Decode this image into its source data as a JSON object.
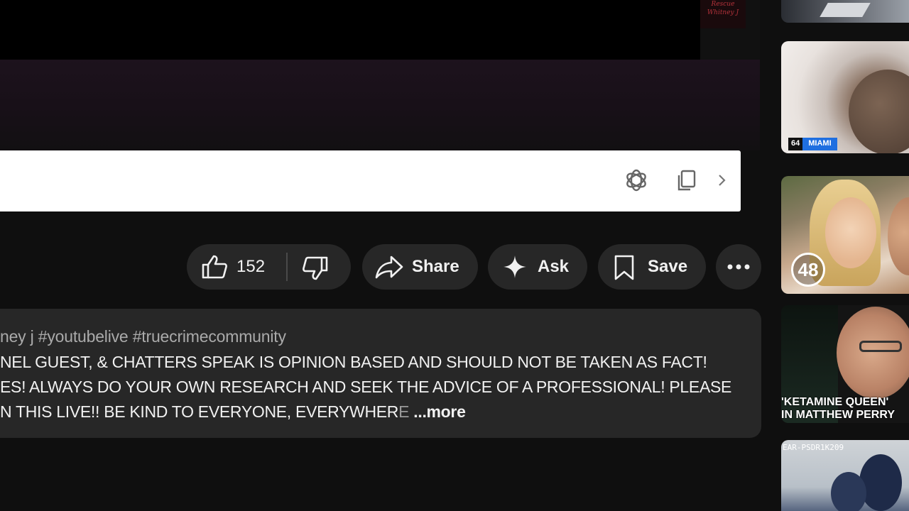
{
  "player": {
    "watermark": "Rescue Whitney J"
  },
  "extension_bar": {
    "icons": [
      "openai-icon",
      "copy-icon",
      "chevron-right-icon"
    ]
  },
  "actions": {
    "like_count": "152",
    "share_label": "Share",
    "ask_label": "Ask",
    "save_label": "Save",
    "icons": [
      "thumbs-up-icon",
      "thumbs-down-icon",
      "share-arrow-icon",
      "sparkle-icon",
      "bookmark-icon",
      "more-horizontal-icon"
    ]
  },
  "description": {
    "tags": "ney j #youtubelive #truecrimecommunity",
    "line1": "NEL GUEST, & CHATTERS SPEAK IS OPINION BASED AND SHOULD NOT BE TAKEN AS FACT!",
    "line2": "ES!  ALWAYS DO YOUR OWN RESEARCH AND SEEK THE ADVICE OF A PROFESSIONAL!  PLEASE",
    "line3_main": "N THIS LIVE!!  BE KIND TO EVERYONE, EVERYWHER",
    "line3_fade": "E",
    "more_label": "...more"
  },
  "sidebar": {
    "thumbs": [
      {
        "caption": ""
      },
      {
        "channel": "64",
        "city": "MIAMI"
      },
      {
        "badge": "48"
      },
      {
        "caption1": "'KETAMINE QUEEN'",
        "caption2": "IN MATTHEW PERRY"
      },
      {
        "overlay": "EAR-PSDR1K209"
      }
    ]
  }
}
